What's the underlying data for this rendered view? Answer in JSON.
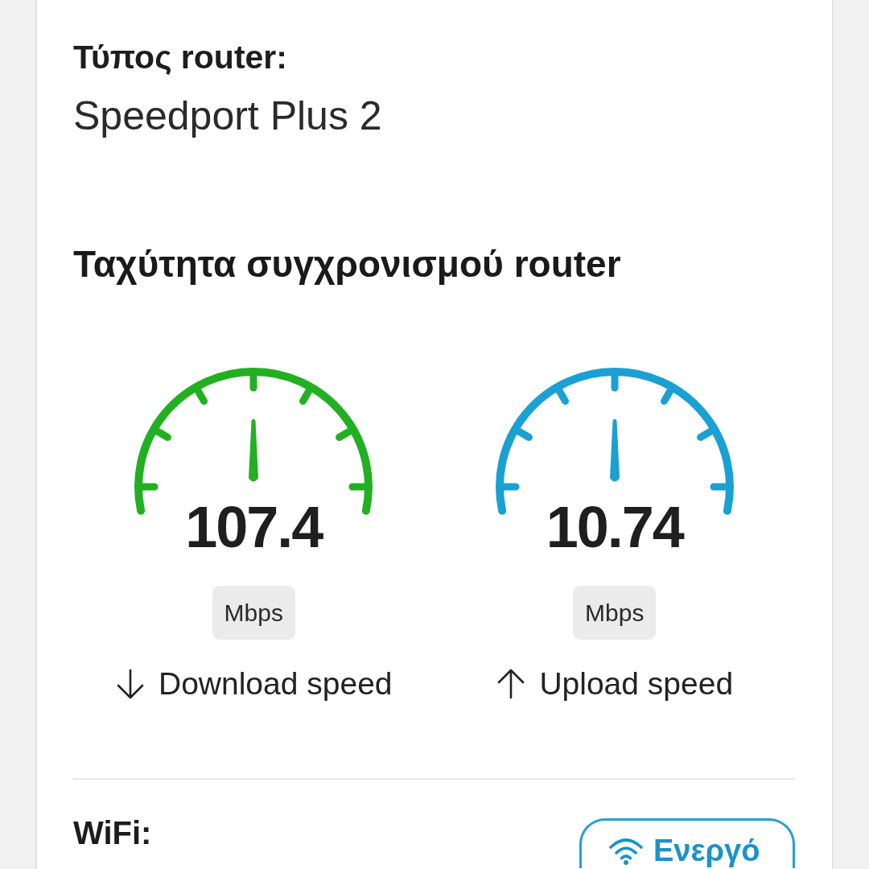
{
  "router_type": {
    "label": "Τύπος router:",
    "value": "Speedport Plus 2"
  },
  "sync_speed": {
    "title": "Ταχύτητα συγχρονισμού router",
    "gauges": [
      {
        "kind": "download",
        "value": "107.4",
        "unit": "Mbps",
        "label": "Download speed",
        "color": "#22b022"
      },
      {
        "kind": "upload",
        "value": "10.74",
        "unit": "Mbps",
        "label": "Upload speed",
        "color": "#1ba0d4"
      }
    ]
  },
  "wifi": {
    "label": "WiFi:",
    "status_button": "Ενεργό"
  }
}
